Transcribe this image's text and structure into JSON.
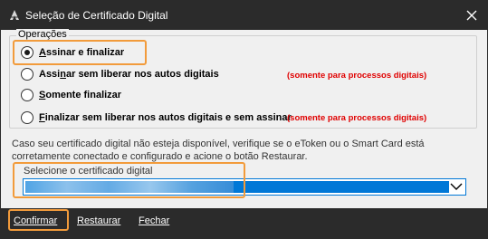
{
  "window": {
    "title": "Seleção de Certificado Digital"
  },
  "operations": {
    "legend": "Operações",
    "options": [
      {
        "label": "Assinar e finalizar",
        "accel": "A",
        "rest": "ssinar e finalizar",
        "checked": true,
        "note": ""
      },
      {
        "label": "Assinar sem liberar nos autos digitais",
        "accel": "n",
        "pre": "Assi",
        "rest": "ar sem liberar nos autos digitais",
        "checked": false,
        "note": "(somente para processos digitais)"
      },
      {
        "label": "Somente finalizar",
        "accel": "S",
        "rest": "omente finalizar",
        "checked": false,
        "note": ""
      },
      {
        "label": "Finalizar sem liberar nos autos digitais e sem assinar",
        "accel": "F",
        "rest": "inalizar sem liberar nos autos digitais e sem assinar",
        "checked": false,
        "note": "(somente para processos digitais)"
      }
    ]
  },
  "info_text": "Caso seu certificado digital não esteja disponível, verifique se o eToken ou o Smart Card está corretamente conectado e configurado e acione o botão Restaurar.",
  "certificate": {
    "legend": "Selecione o certificado digital",
    "selected_value": ""
  },
  "footer": {
    "confirm": "Confirmar",
    "restore": "Restaurar",
    "close": "Fechar"
  },
  "colors": {
    "titlebar": "#2b2b2b",
    "highlight": "#f29b3b",
    "note": "#e00000",
    "selection": "#0078d7"
  },
  "icons": {
    "app": "feather-pen-icon",
    "close": "close-icon",
    "dropdown": "chevron-down-icon"
  }
}
